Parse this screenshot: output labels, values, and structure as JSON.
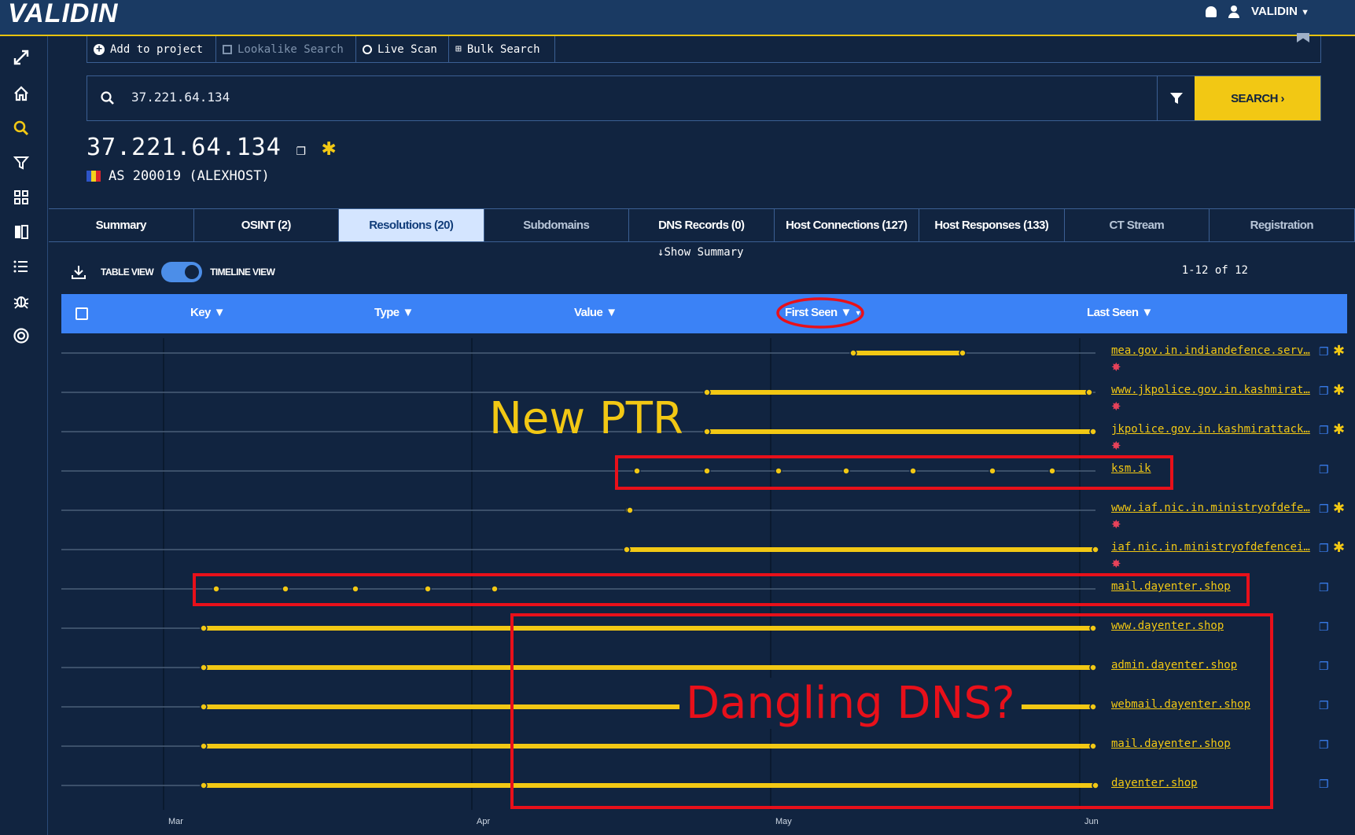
{
  "brand": {
    "logo": "VALIDIN",
    "user": "VALIDIN"
  },
  "actions": {
    "add_to_project": "Add to project",
    "lookalike": "Lookalike Search",
    "live_scan": "Live Scan",
    "bulk": "Bulk Search"
  },
  "search": {
    "value": "37.221.64.134",
    "button": "SEARCH"
  },
  "entity": {
    "ip": "37.221.64.134",
    "asn": "AS 200019 (ALEXHOST)"
  },
  "tabs": [
    "Summary",
    "OSINT (2)",
    "Resolutions (20)",
    "Subdomains",
    "DNS Records (0)",
    "Host Connections (127)",
    "Host Responses (133)",
    "CT Stream",
    "Registration"
  ],
  "view": {
    "show_summary": "Show Summary",
    "table": "TABLE VIEW",
    "timeline": "TIMELINE VIEW",
    "pager": "1-12 of 12"
  },
  "columns": {
    "key": "Key",
    "type": "Type",
    "value": "Value",
    "first_seen": "First Seen",
    "last_seen": "Last Seen"
  },
  "axis": {
    "months": [
      "Mar",
      "Apr",
      "May",
      "Jun"
    ]
  },
  "rows": [
    {
      "domain": "mea.gov.in.indiandefence.serv…",
      "flagged": true
    },
    {
      "domain": "www.jkpolice.gov.in.kashmirat…",
      "flagged": true
    },
    {
      "domain": "jkpolice.gov.in.kashmirattack…",
      "flagged": true
    },
    {
      "domain": "ksm.ik",
      "flagged": false
    },
    {
      "domain": "www.iaf.nic.in.ministryofdefe…",
      "flagged": true
    },
    {
      "domain": "iaf.nic.in.ministryofdefencei…",
      "flagged": true
    },
    {
      "domain": "mail.dayenter.shop",
      "flagged": false
    },
    {
      "domain": "www.dayenter.shop",
      "flagged": false
    },
    {
      "domain": "admin.dayenter.shop",
      "flagged": false
    },
    {
      "domain": "webmail.dayenter.shop",
      "flagged": false
    },
    {
      "domain": "mail.dayenter.shop",
      "flagged": false
    },
    {
      "domain": "dayenter.shop",
      "flagged": false
    }
  ],
  "annotations": {
    "new_ptr": "New PTR",
    "dangling": "Dangling DNS?"
  },
  "colors": {
    "accent": "#f2c814",
    "header": "#3b82f6",
    "annotation": "#e8101a",
    "bg": "#112440"
  }
}
